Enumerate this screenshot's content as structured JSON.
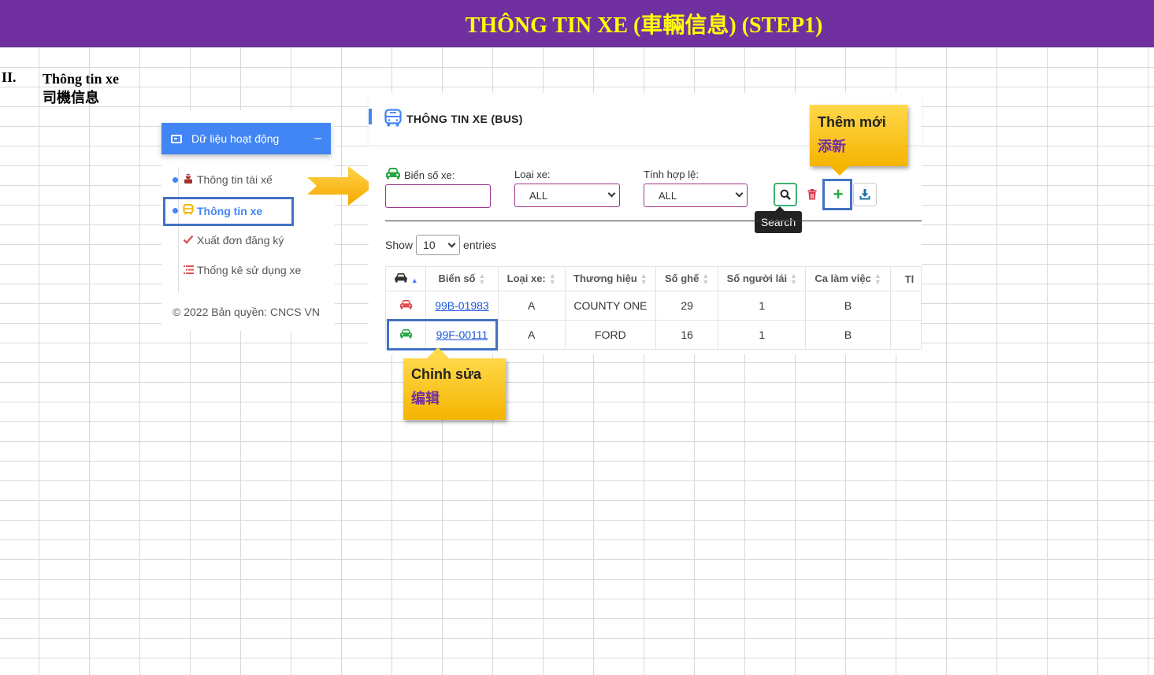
{
  "banner": {
    "title": "THÔNG TIN XE (車輛信息) (STEP1)"
  },
  "section": {
    "number": "II.",
    "title_vi": "Thông tin xe",
    "title_zh": "司機信息"
  },
  "sidebar": {
    "header_label": "Dữ liệu hoạt động",
    "collapse_symbol": "–",
    "items": [
      {
        "label": "Thông tin tài xế",
        "icon": "driver-icon"
      },
      {
        "label": "Thông tin xe",
        "icon": "bus-icon"
      },
      {
        "label": "Xuất đơn đăng ký",
        "icon": "check-icon"
      },
      {
        "label": "Thống kê sử dụng xe",
        "icon": "list-icon"
      }
    ],
    "copyright": "© 2022 Bản quyền: CNCS VN"
  },
  "main": {
    "title": "THÔNG TIN XE (BUS)",
    "filters": {
      "plate_label": "Biển số xe:",
      "plate_value": "",
      "type_label": "Loại xe:",
      "type_value": "ALL",
      "valid_label": "Tính hợp lệ:",
      "valid_value": "ALL"
    },
    "search_tooltip": "Search",
    "add_symbol": "+",
    "show_label": "Show",
    "entries_label": "entries",
    "page_length": "10",
    "columns": [
      "",
      "Biển số",
      "Loại xe:",
      "Thương hiệu",
      "Số ghế",
      "Số người lái",
      "Ca làm việc",
      "Tl"
    ],
    "rows": [
      {
        "plate": "99B-01983",
        "type": "A",
        "brand": "COUNTY ONE",
        "seats": "29",
        "drivers": "1",
        "shift": "B",
        "icon_color": "#e04848"
      },
      {
        "plate": "99F-00111",
        "type": "A",
        "brand": "FORD",
        "seats": "16",
        "drivers": "1",
        "shift": "B",
        "icon_color": "#28a745"
      }
    ]
  },
  "callouts": {
    "add": {
      "line1": "Thêm mới",
      "line2": "添新"
    },
    "edit": {
      "line1": "Chỉnh sửa",
      "line2": "编辑"
    }
  },
  "colors": {
    "banner_bg": "#7030a0",
    "banner_text": "#ffff00",
    "accent": "#4285f4",
    "highlight_box": "#4472c4",
    "callout": "#ffc000"
  }
}
